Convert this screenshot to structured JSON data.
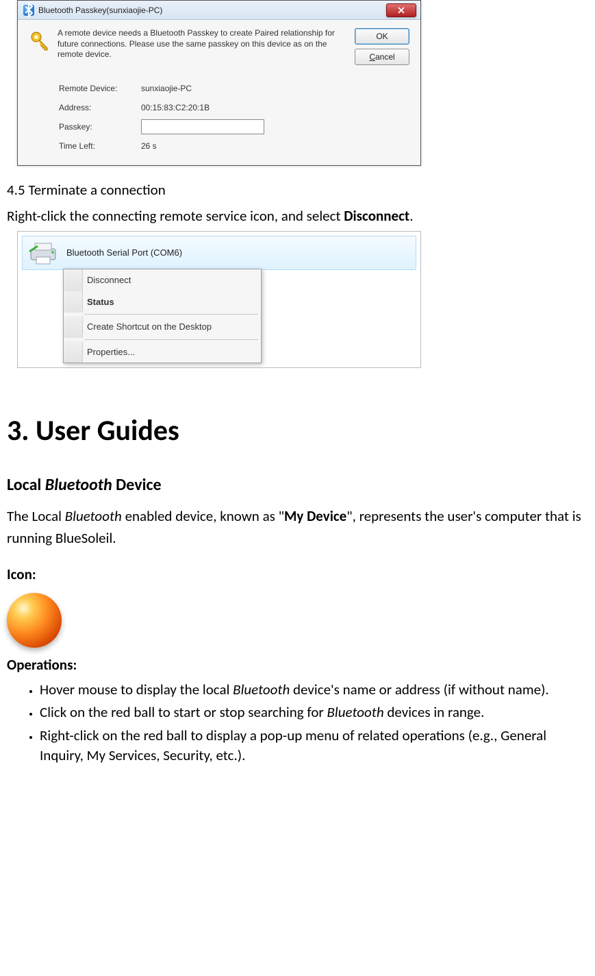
{
  "dialog": {
    "title": "Bluetooth Passkey(sunxiaojie-PC)",
    "message": "A remote device needs a Bluetooth Passkey to create Paired relationship for future connections. Please use the same passkey on this device as on the remote device.",
    "ok": "OK",
    "cancel": "Cancel",
    "cancel_u": "C",
    "fields": {
      "remote_device_label": "Remote Device:",
      "remote_device_value": "sunxiaojie-PC",
      "address_label": "Address:",
      "address_value": "00:15:83:C2:20:1B",
      "passkey_label": "Passkey:",
      "passkey_value": "",
      "time_left_label": "Time Left:",
      "time_left_value": "26 s"
    }
  },
  "sec45_heading": "4.5 Terminate a connection",
  "sec45_body_pre": "Right-click the connecting remote service icon, and select ",
  "sec45_body_bold": "Disconnect",
  "sec45_body_post": ".",
  "ctx": {
    "row_label": "Bluetooth Serial Port (COM6)",
    "disconnect": "Disconnect",
    "status": "Status",
    "shortcut": "Create Shortcut on the Desktop",
    "properties": "Properties..."
  },
  "h1": "3. User Guides",
  "h2_local_pre": "Local ",
  "h2_local_it": "Bluetooth",
  "h2_local_post": " Device",
  "p_local_1": "The Local ",
  "p_local_2": "Bluetooth",
  "p_local_3": " enabled device, known as \"",
  "p_local_4": "My Device",
  "p_local_5": "\", represents the user's computer that is running BlueSoleil.",
  "icon_label": "Icon:",
  "ops_label": "Operations:",
  "ops": {
    "i1a": "Hover mouse to display the local ",
    "i1b": "Bluetooth",
    "i1c": " device's name or address (if without name).",
    "i2a": "Click on the red ball to start or stop searching for ",
    "i2b": "Bluetooth",
    "i2c": " devices in range.",
    "i3": "Right-click on the red ball to display a pop-up menu of related operations (e.g., General Inquiry, My Services, Security, etc.)."
  }
}
